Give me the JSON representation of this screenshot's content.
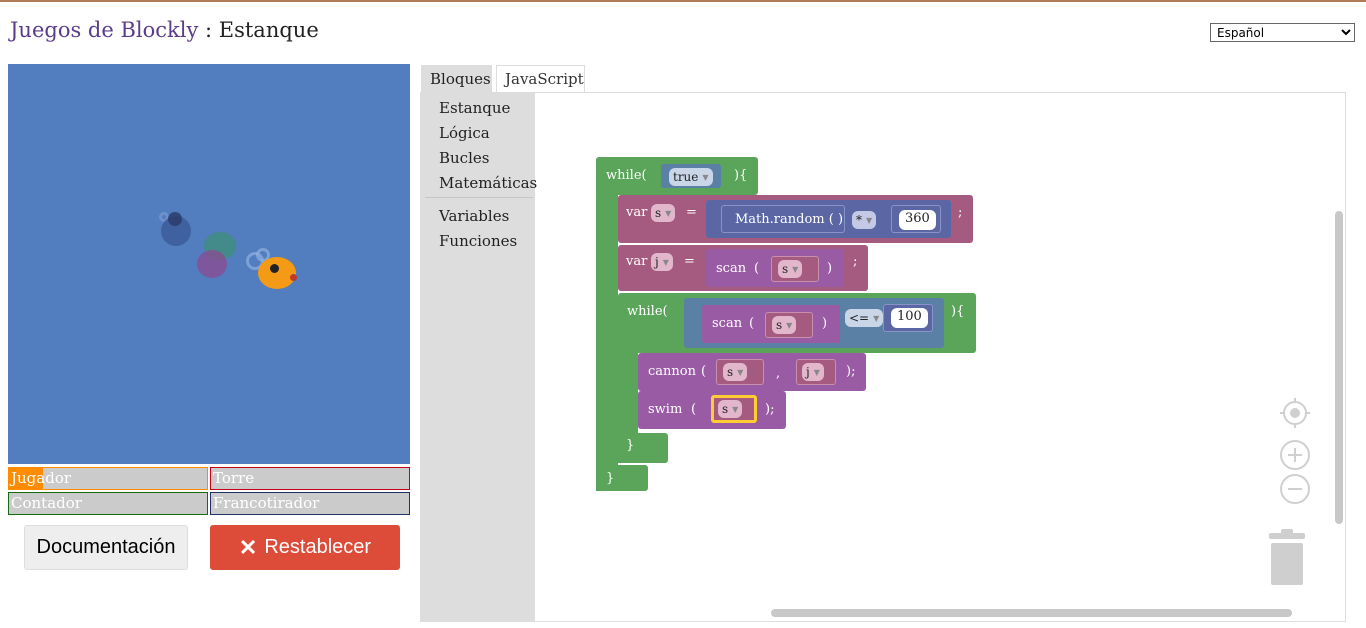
{
  "header": {
    "title_app": "Juegos de Blockly",
    "title_sep": " : ",
    "title_page": "Estanque"
  },
  "language": {
    "selected": "Español"
  },
  "status": {
    "player": "Jugador",
    "rook": "Torre",
    "counter": "Contador",
    "sniper": "Francotirador",
    "colors": {
      "player": "#ff8b00",
      "rook": "#c90015",
      "counter": "#166c0b",
      "sniper": "#223068"
    },
    "health": {
      "player": 0.17,
      "rook": 0,
      "counter": 0,
      "sniper": 0
    }
  },
  "buttons": {
    "docs": "Documentación",
    "reset": "Restablecer",
    "reset_icon": "close-icon"
  },
  "tabs": {
    "blocks": "Bloques",
    "javascript": "JavaScript"
  },
  "toolbox": {
    "pond": "Estanque",
    "logic": "Lógica",
    "loops": "Bucles",
    "math": "Matemáticas",
    "variables": "Variables",
    "functions": "Funciones"
  },
  "code": {
    "while_open": "while(",
    "true_value": "true",
    "brace_open": "){",
    "var_kw": "var",
    "var_s": "s",
    "eq": "=",
    "math_random": "Math.random ( )",
    "times": "*",
    "n360": "360",
    "semi": ";",
    "var_j": "j",
    "scan": "scan",
    "paren_open": "(",
    "paren_close": ")",
    "lte": "<=",
    "n100": "100",
    "cannon": "cannon",
    "comma": ",",
    "semi_close": ");",
    "swim": "swim",
    "brace_close": "}"
  },
  "controls": [
    "target-icon",
    "zoom-in-icon",
    "zoom-out-icon",
    "trash-icon"
  ]
}
